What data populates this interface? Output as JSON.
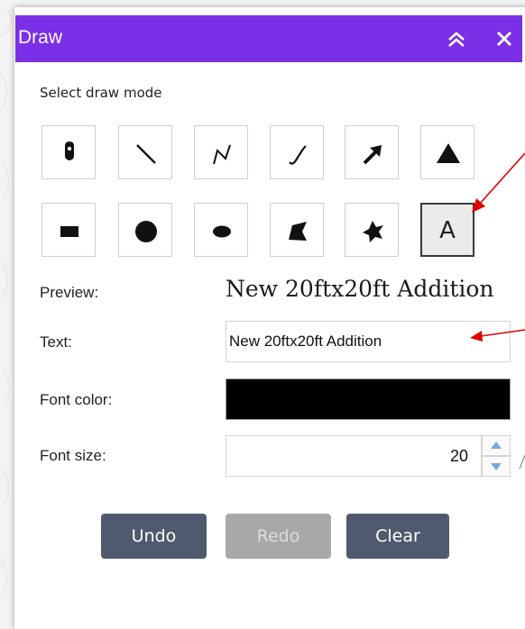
{
  "window": {
    "title": "Draw"
  },
  "draw_mode": {
    "label": "Select draw mode",
    "tools": [
      {
        "name": "point",
        "icon": "map-pin-icon"
      },
      {
        "name": "line",
        "icon": "line-icon"
      },
      {
        "name": "polyline",
        "icon": "polyline-icon"
      },
      {
        "name": "freehand-polyline",
        "icon": "freehand-line-icon"
      },
      {
        "name": "arrow",
        "icon": "arrow-icon"
      },
      {
        "name": "triangle",
        "icon": "triangle-icon"
      },
      {
        "name": "rectangle",
        "icon": "rectangle-icon"
      },
      {
        "name": "circle",
        "icon": "circle-icon"
      },
      {
        "name": "ellipse",
        "icon": "ellipse-icon"
      },
      {
        "name": "polygon",
        "icon": "polygon-icon"
      },
      {
        "name": "freehand-polygon",
        "icon": "freehand-polygon-icon"
      },
      {
        "name": "text",
        "icon": "text-icon",
        "glyph": "A",
        "selected": true
      }
    ]
  },
  "form": {
    "preview_label": "Preview:",
    "preview_value": "New 20ftx20ft Addition",
    "text_label": "Text:",
    "text_value": "New 20ftx20ft Addition",
    "font_color_label": "Font color:",
    "font_color_value": "#000000",
    "font_size_label": "Font size:",
    "font_size_value": "20"
  },
  "buttons": {
    "undo": "Undo",
    "redo": "Redo",
    "clear": "Clear"
  },
  "colors": {
    "titlebar": "#7b2fe6",
    "button": "#4f5a6e",
    "button_disabled": "#a8a8aa",
    "annotation_arrow": "#e00000"
  }
}
